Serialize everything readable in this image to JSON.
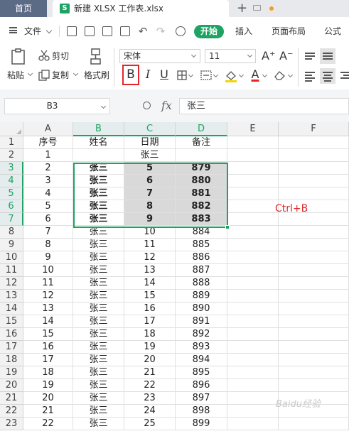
{
  "titlebar": {
    "home_tab": "首页",
    "doc_tab": "新建 XLSX 工作表.xlsx",
    "doc_badge": "S",
    "add_tab": "+"
  },
  "menubar": {
    "file": "文件",
    "start": "开始",
    "insert": "插入",
    "page_layout": "页面布局",
    "formula": "公式"
  },
  "ribbon": {
    "paste": "粘贴",
    "cut": "剪切",
    "copy": "复制",
    "format_painter": "格式刷",
    "font_name": "宋体",
    "font_size": "11",
    "bold": "B",
    "italic": "I",
    "underline": "U",
    "grow_font": "A⁺",
    "shrink_font": "A⁻",
    "font_color_glyph": "A"
  },
  "formula_bar": {
    "cell_ref": "B3",
    "fx": "fx",
    "content": "张三"
  },
  "columns": [
    "A",
    "B",
    "C",
    "D",
    "E",
    "F"
  ],
  "rows": [
    "1",
    "2",
    "3",
    "4",
    "5",
    "6",
    "7",
    "8",
    "9",
    "10",
    "11",
    "12",
    "13",
    "14",
    "15",
    "16",
    "17",
    "18",
    "19",
    "20",
    "21",
    "22",
    "23"
  ],
  "cells": [
    [
      "序号",
      "姓名",
      "日期",
      "备注",
      "",
      ""
    ],
    [
      "1",
      "",
      "张三",
      "",
      "",
      ""
    ],
    [
      "2",
      "张三",
      "5",
      "879",
      "",
      ""
    ],
    [
      "3",
      "张三",
      "6",
      "880",
      "",
      ""
    ],
    [
      "4",
      "张三",
      "7",
      "881",
      "",
      ""
    ],
    [
      "5",
      "张三",
      "8",
      "882",
      "",
      ""
    ],
    [
      "6",
      "张三",
      "9",
      "883",
      "",
      ""
    ],
    [
      "7",
      "张三",
      "10",
      "884",
      "",
      ""
    ],
    [
      "8",
      "张三",
      "11",
      "885",
      "",
      ""
    ],
    [
      "9",
      "张三",
      "12",
      "886",
      "",
      ""
    ],
    [
      "10",
      "张三",
      "13",
      "887",
      "",
      ""
    ],
    [
      "11",
      "张三",
      "14",
      "888",
      "",
      ""
    ],
    [
      "12",
      "张三",
      "15",
      "889",
      "",
      ""
    ],
    [
      "13",
      "张三",
      "16",
      "890",
      "",
      ""
    ],
    [
      "14",
      "张三",
      "17",
      "891",
      "",
      ""
    ],
    [
      "15",
      "张三",
      "18",
      "892",
      "",
      ""
    ],
    [
      "16",
      "张三",
      "19",
      "893",
      "",
      ""
    ],
    [
      "17",
      "张三",
      "20",
      "894",
      "",
      ""
    ],
    [
      "18",
      "张三",
      "21",
      "895",
      "",
      ""
    ],
    [
      "19",
      "张三",
      "22",
      "896",
      "",
      ""
    ],
    [
      "20",
      "张三",
      "23",
      "897",
      "",
      ""
    ],
    [
      "21",
      "张三",
      "24",
      "898",
      "",
      ""
    ],
    [
      "22",
      "张三",
      "25",
      "899",
      "",
      ""
    ]
  ],
  "selection": {
    "range": "B3:D7"
  },
  "annotation": "Ctrl+B",
  "watermark": "Baidu经验",
  "colors": {
    "accent": "#1fa363",
    "highlight": "#e0282a",
    "selection_fill": "#d9d9d9"
  }
}
